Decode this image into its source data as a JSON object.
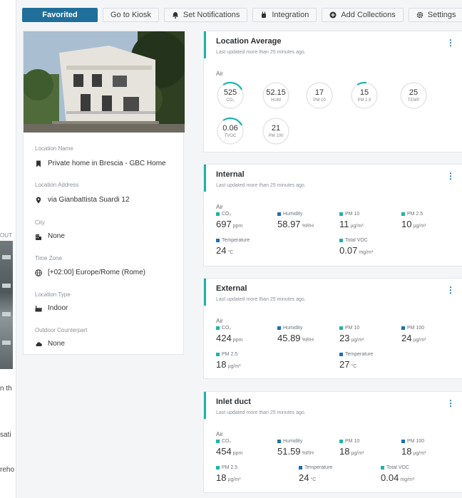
{
  "background": {
    "frag_out": "OUT",
    "frag_th": "n th",
    "frag_sati": "sati",
    "frag_reho": "reho"
  },
  "toolbar": {
    "favorited": "Favorited",
    "go_to_kiosk": "Go to Kiosk",
    "set_notifications": "Set Notifications",
    "integration": "Integration",
    "add_collections": "Add Collections",
    "settings": "Settings"
  },
  "location": {
    "name_label": "Location Name",
    "name": "Private home in Brescia - GBC Home",
    "address_label": "Location Address",
    "address": "via Gianbattista Suardi 12",
    "city_label": "City",
    "city": "None",
    "timezone_label": "Time Zone",
    "timezone": "[+02:00] Europe/Rome (Rome)",
    "type_label": "Location Type",
    "type": "Indoor",
    "outdoor_label": "Outdoor Counterpart",
    "outdoor": "None"
  },
  "colors": {
    "accent_teal": "#1fb3a8",
    "primary_blue": "#1f6f9a",
    "co2": "#1fb3a8",
    "humidity": "#1f6fb0",
    "pm10": "#1fb3a8",
    "pm25": "#1fb3a8",
    "pm100": "#1f6fb0",
    "temperature": "#1f6fb0",
    "tvoc": "#1fb3a8"
  },
  "average": {
    "title": "Location Average",
    "updated": "Last updated more than 25 minutes ago.",
    "section": "Air",
    "gauges": [
      {
        "value": "525",
        "label": "CO₂",
        "arc": 0.25
      },
      {
        "value": "52.15",
        "label": "HUM",
        "arc": 0
      },
      {
        "value": "17",
        "label": "PM 10",
        "arc": 0
      },
      {
        "value": "15",
        "label": "PM 2.5",
        "arc": 0.1
      },
      {
        "value": "25",
        "label": "TEMP",
        "arc": 0
      },
      {
        "value": "0.06",
        "label": "TVOC",
        "arc": 0.25
      },
      {
        "value": "21",
        "label": "PM 100",
        "arc": 0
      }
    ]
  },
  "internal": {
    "title": "Internal",
    "updated": "Last updated more than 25 minutes ago.",
    "section": "Air",
    "metrics": [
      {
        "label": "CO₂",
        "value": "697",
        "unit": "ppm",
        "color": "#1fb3a8"
      },
      {
        "label": "Humidity",
        "value": "58.97",
        "unit": "%RH",
        "color": "#1f6fb0"
      },
      {
        "label": "PM 10",
        "value": "11",
        "unit": "µg/m³",
        "color": "#1fb3a8"
      },
      {
        "label": "PM 2.5",
        "value": "10",
        "unit": "µg/m³",
        "color": "#1fb3a8"
      },
      {
        "label": "Temperature",
        "value": "24",
        "unit": "°C",
        "color": "#1f6fb0"
      },
      {
        "label": "Total VOC",
        "value": "0.07",
        "unit": "mg/m³",
        "color": "#1fb3a8"
      }
    ]
  },
  "external": {
    "title": "External",
    "updated": "Last updated more than 25 minutes ago.",
    "section": "Air",
    "metrics": [
      {
        "label": "CO₂",
        "value": "424",
        "unit": "ppm",
        "color": "#1fb3a8"
      },
      {
        "label": "Humidity",
        "value": "45.89",
        "unit": "%RH",
        "color": "#1f6fb0"
      },
      {
        "label": "PM 10",
        "value": "23",
        "unit": "µg/m³",
        "color": "#1fb3a8"
      },
      {
        "label": "PM 100",
        "value": "24",
        "unit": "µg/m³",
        "color": "#1f6fb0"
      },
      {
        "label": "PM 2.5",
        "value": "18",
        "unit": "µg/m³",
        "color": "#1fb3a8"
      },
      {
        "label": "Temperature",
        "value": "27",
        "unit": "°C",
        "color": "#1f6fb0"
      }
    ]
  },
  "inlet": {
    "title": "Inlet duct",
    "updated": "Last updated more than 25 minutes ago.",
    "section": "Air",
    "metrics": [
      {
        "label": "CO₂",
        "value": "454",
        "unit": "ppm",
        "color": "#1fb3a8"
      },
      {
        "label": "Humidity",
        "value": "51.59",
        "unit": "%RH",
        "color": "#1f6fb0"
      },
      {
        "label": "PM 10",
        "value": "18",
        "unit": "µg/m³",
        "color": "#1fb3a8"
      },
      {
        "label": "PM 100",
        "value": "18",
        "unit": "µg/m³",
        "color": "#1f6fb0"
      },
      {
        "label": "PM 2.5",
        "value": "18",
        "unit": "µg/m³",
        "color": "#1fb3a8"
      },
      {
        "label": "Temperature",
        "value": "24",
        "unit": "°C",
        "color": "#1f6fb0"
      },
      {
        "label": "Total VOC",
        "value": "0.04",
        "unit": "mg/m³",
        "color": "#1fb3a8"
      }
    ]
  }
}
